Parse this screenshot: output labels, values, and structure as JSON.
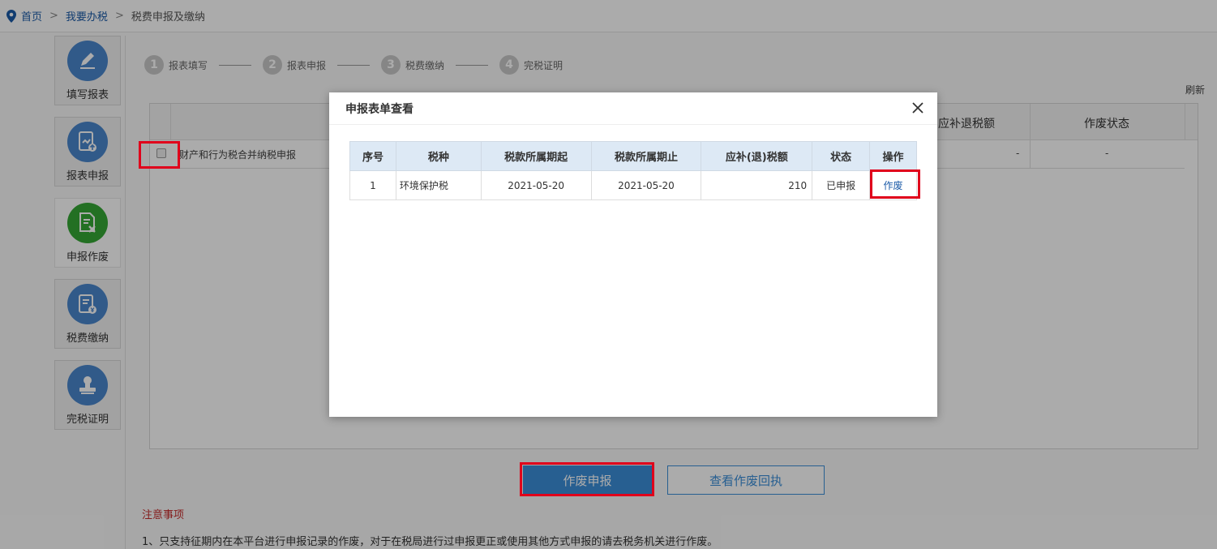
{
  "breadcrumb": {
    "home": "首页",
    "level2": "我要办税",
    "current": "税费申报及缴纳",
    "separator": ">"
  },
  "sidebar": {
    "items": [
      {
        "label": "填写报表",
        "icon": "pencil-icon"
      },
      {
        "label": "报表申报",
        "icon": "report-upload-icon"
      },
      {
        "label": "申报作废",
        "icon": "void-document-icon"
      },
      {
        "label": "税费缴纳",
        "icon": "tax-payment-icon"
      },
      {
        "label": "完税证明",
        "icon": "stamp-icon"
      }
    ]
  },
  "steps": [
    {
      "num": "1",
      "label": "报表填写"
    },
    {
      "num": "2",
      "label": "报表申报"
    },
    {
      "num": "3",
      "label": "税费缴纳"
    },
    {
      "num": "4",
      "label": "完税证明"
    }
  ],
  "refresh_label": "刷新",
  "bg_table": {
    "headers": {
      "refund": "应补退税额",
      "void_status": "作废状态"
    },
    "row": {
      "name": "财产和行为税合并纳税申报",
      "refund": "-",
      "void_status": "-"
    }
  },
  "buttons": {
    "void_submit": "作废申报",
    "view_receipt": "查看作废回执"
  },
  "notice": {
    "title": "注意事项",
    "line1": "1、只支持征期内在本平台进行申报记录的作废，对于在税局进行过申报更正或使用其他方式申报的请去税务机关进行作废。"
  },
  "modal": {
    "title": "申报表单查看",
    "close_icon": "close-icon",
    "headers": [
      "序号",
      "税种",
      "税款所属期起",
      "税款所属期止",
      "应补(退)税额",
      "状态",
      "操作"
    ],
    "rows": [
      {
        "seq": "1",
        "tax": "环境保护税",
        "start": "2021-05-20",
        "end": "2021-05-20",
        "amount": "210",
        "status": "已申报",
        "action": "作废"
      }
    ]
  },
  "colors": {
    "primary": "#3b8ed8",
    "highlight": "#e0001b",
    "active_icon": "#35a735",
    "icon": "#4a86cc"
  }
}
